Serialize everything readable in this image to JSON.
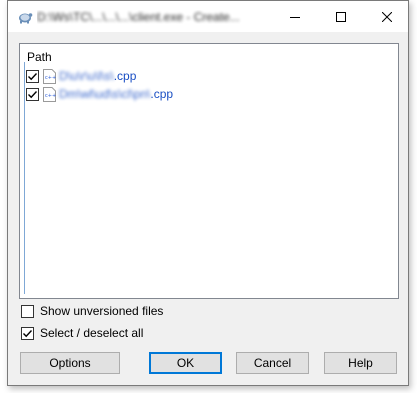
{
  "window": {
    "title": "D:\\Ws\\TC\\...\\...\\...\\client.exe - Create...",
    "controls": {
      "minimize_icon": "minimize-icon",
      "maximize_icon": "maximize-icon",
      "close_icon": "close-icon"
    }
  },
  "file_list": {
    "column_header": "Path",
    "rows": [
      {
        "checked": true,
        "path_prefix": "D\\u\\r\\u\\l\\s\\",
        "path_ext": ".cpp"
      },
      {
        "checked": true,
        "path_prefix": "Dm\\wl\\ud\\s\\cl\\pn\\",
        "path_ext": ".cpp"
      }
    ]
  },
  "options": {
    "show_unversioned": {
      "label": "Show unversioned files",
      "checked": false
    },
    "select_all": {
      "label": "Select / deselect all",
      "checked": true
    }
  },
  "buttons": {
    "options": "Options",
    "ok": "OK",
    "cancel": "Cancel",
    "help": "Help"
  },
  "colors": {
    "accent": "#0078d7",
    "link_text": "#1a4fc4",
    "dialog_bg": "#f0f0f0"
  }
}
